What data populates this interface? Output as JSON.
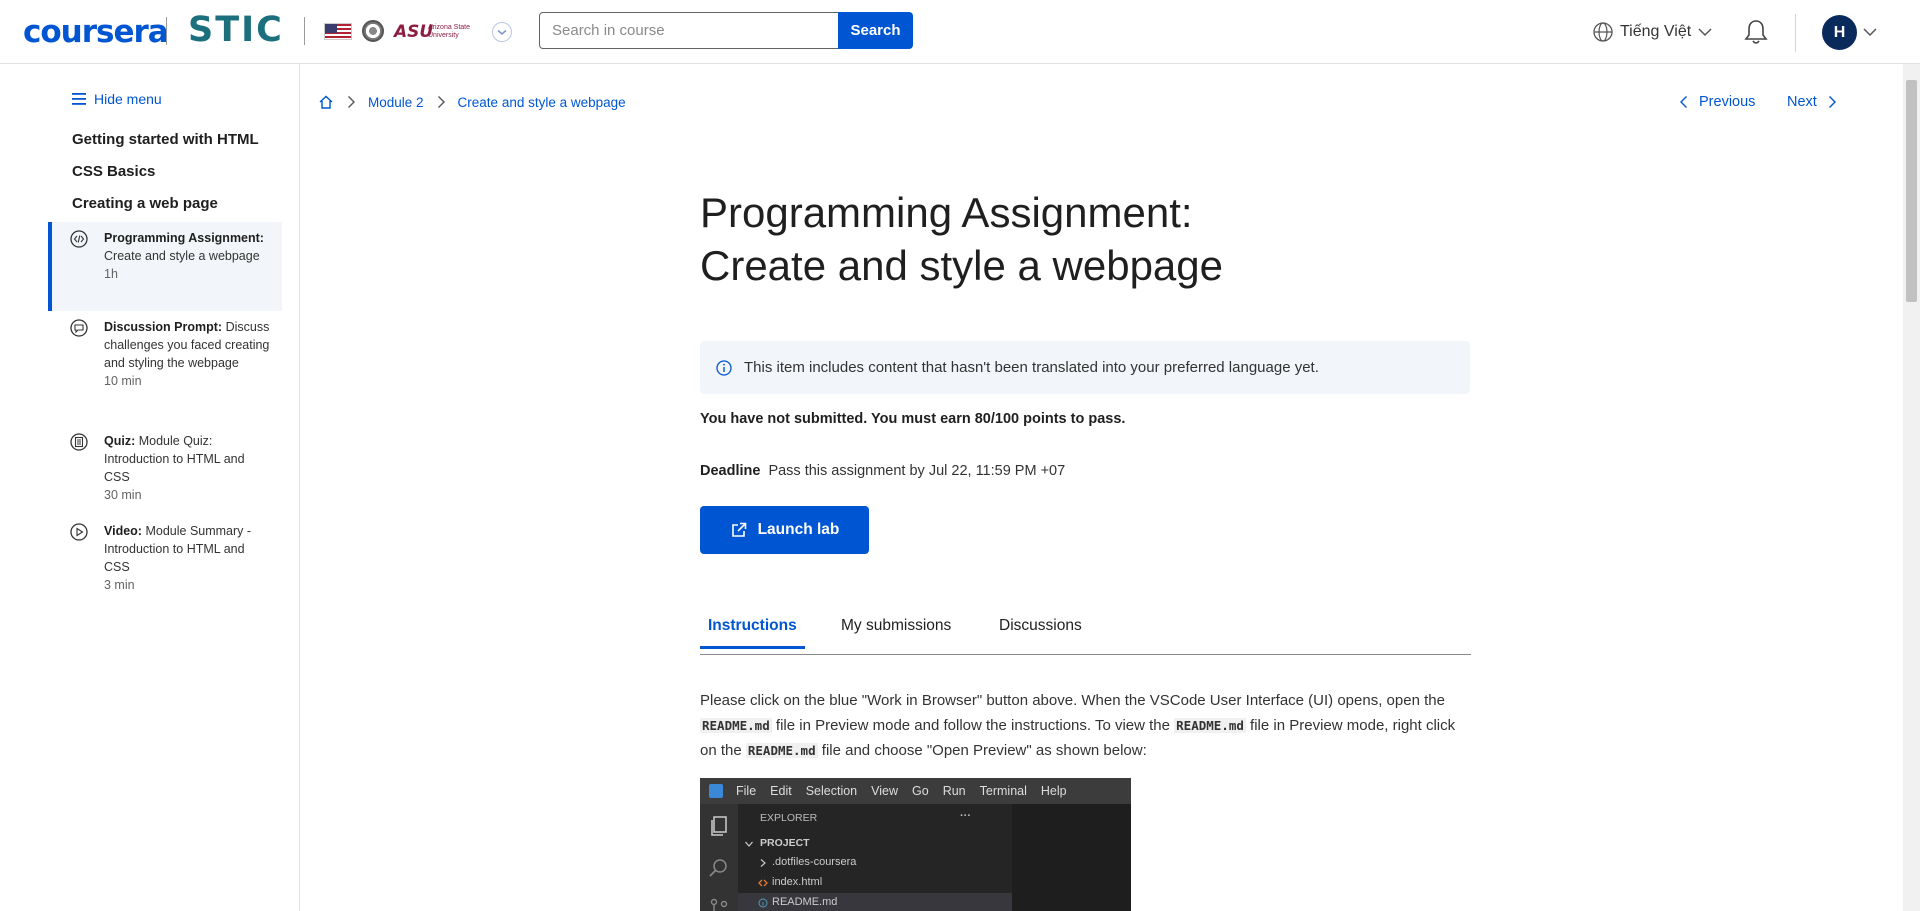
{
  "header": {
    "logo": "coursera",
    "partner": "STIC",
    "asu_logo": "ASU",
    "asu_subtitle": "Arizona State University",
    "search_placeholder": "Search in course",
    "search_button": "Search",
    "language": "Tiếng Việt",
    "avatar_initial": "H"
  },
  "sidebar": {
    "hide_menu": "Hide menu",
    "sections": [
      "Getting started with HTML",
      "CSS Basics",
      "Creating a web page"
    ],
    "items": [
      {
        "type": "Programming Assignment:",
        "title": "Create and style a webpage",
        "duration": "1h",
        "icon": "code-icon",
        "active": true
      },
      {
        "type": "Discussion Prompt:",
        "title": "Discuss challenges you faced creating and styling the webpage",
        "duration": "10 min",
        "icon": "chat-bubble-icon",
        "active": false
      },
      {
        "type": "Quiz:",
        "title": "Module Quiz: Introduction to HTML and CSS",
        "duration": "30 min",
        "icon": "quiz-icon",
        "active": false
      },
      {
        "type": "Video:",
        "title": "Module Summary - Introduction to HTML and CSS",
        "duration": "3 min",
        "icon": "play-icon",
        "active": false
      }
    ]
  },
  "breadcrumb": {
    "items": [
      "Module 2",
      "Create and style a webpage"
    ],
    "previous": "Previous",
    "next": "Next"
  },
  "main": {
    "title": "Programming Assignment: Create and style a webpage",
    "banner": "This item includes content that hasn't been translated into your preferred language yet.",
    "status": "You have not submitted. You must earn 80/100 points to pass.",
    "deadline_label": "Deadline",
    "deadline_value": "Pass this assignment by Jul 22, 11:59 PM +07",
    "launch_button": "Launch lab",
    "tabs": [
      "Instructions",
      "My submissions",
      "Discussions"
    ],
    "instructions": {
      "p1": "Please click on the blue \"Work in Browser\" button above. When the VSCode User Interface (UI) opens, open the",
      "code1": "README.md",
      "p2": " file in  Preview mode and follow the instructions. To view the ",
      "code2": "README.md",
      "p3": " file in Preview mode, right click on the ",
      "code3": "README.md",
      "p4": " file and choose \"Open Preview\" as shown below:"
    }
  },
  "vscode": {
    "menu": [
      "File",
      "Edit",
      "Selection",
      "View",
      "Go",
      "Run",
      "Terminal",
      "Help"
    ],
    "explorer": "EXPLORER",
    "more": "···",
    "project": "PROJECT",
    "files": [
      ".dotfiles-coursera",
      "index.html",
      "README.md"
    ]
  },
  "colors": {
    "primary": "#0056d2",
    "sidebar_active_bg": "#f2f5fa",
    "stic": "#1c6f7d",
    "asu": "#8c1d40"
  }
}
